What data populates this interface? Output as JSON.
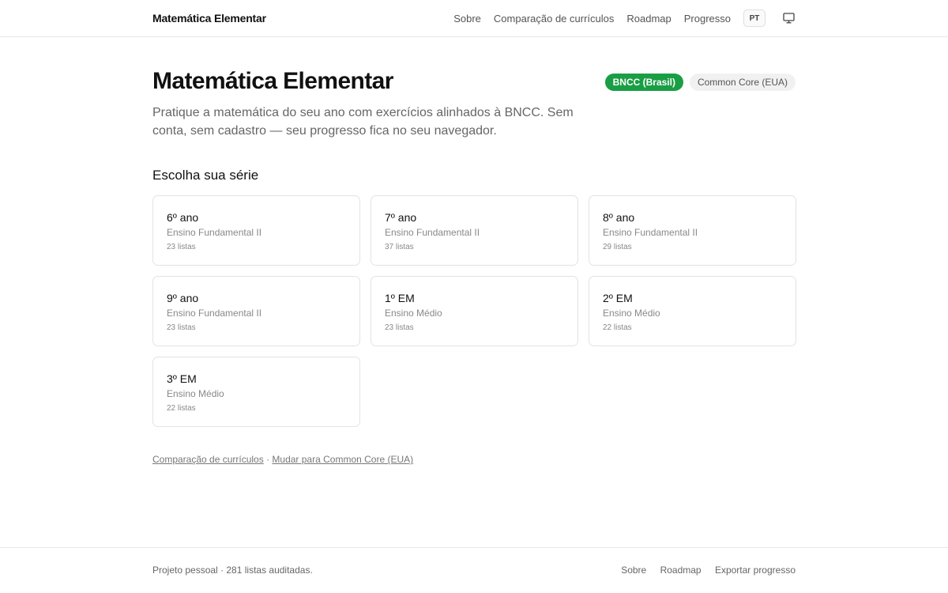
{
  "header": {
    "brand": "Matemática Elementar",
    "nav": [
      "Sobre",
      "Comparação de currículos",
      "Roadmap",
      "Progresso"
    ],
    "lang": "PT",
    "theme_icon": "monitor-icon"
  },
  "hero": {
    "title": "Matemática Elementar",
    "subtitle": "Pratique a matemática do seu ano com exercícios alinhados à BNCC. Sem conta, sem cadastro — seu progresso fica no seu navegador.",
    "curricula": [
      {
        "label": "BNCC (Brasil)",
        "active": true
      },
      {
        "label": "Common Core (EUA)",
        "active": false
      }
    ]
  },
  "grades": {
    "heading": "Escolha sua série",
    "items": [
      {
        "title": "6º ano",
        "stage": "Ensino Fundamental II",
        "count": "23 listas"
      },
      {
        "title": "7º ano",
        "stage": "Ensino Fundamental II",
        "count": "37 listas"
      },
      {
        "title": "8º ano",
        "stage": "Ensino Fundamental II",
        "count": "29 listas"
      },
      {
        "title": "9º ano",
        "stage": "Ensino Fundamental II",
        "count": "23 listas"
      },
      {
        "title": "1º EM",
        "stage": "Ensino Médio",
        "count": "23 listas"
      },
      {
        "title": "2º EM",
        "stage": "Ensino Médio",
        "count": "22 listas"
      },
      {
        "title": "3º EM",
        "stage": "Ensino Médio",
        "count": "22 listas"
      }
    ]
  },
  "bottom_links": {
    "compare": "Comparação de currículos",
    "separator": " · ",
    "switch": "Mudar para Common Core (EUA)"
  },
  "footer": {
    "note": "Projeto pessoal · 281 listas auditadas.",
    "links": [
      "Sobre",
      "Roadmap",
      "Exportar progresso"
    ]
  },
  "colors": {
    "accent": "#1a9e45",
    "text": "#111111",
    "muted": "#888888"
  }
}
